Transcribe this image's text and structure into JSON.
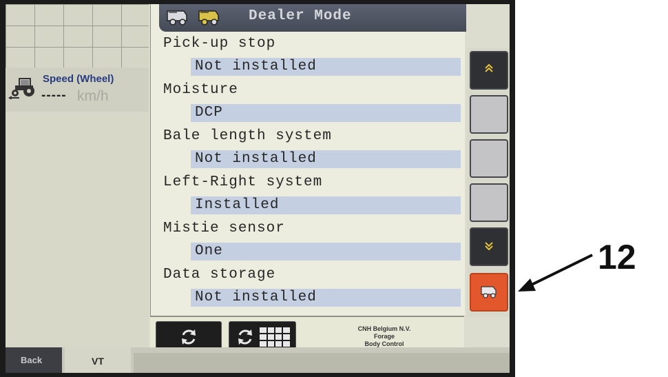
{
  "speed_widget": {
    "label": "Speed (Wheel)",
    "value": "-----",
    "unit": "km/h"
  },
  "header": {
    "title": "Dealer Mode"
  },
  "settings": [
    {
      "label": "Pick-up stop",
      "value": "Not installed"
    },
    {
      "label": "Moisture",
      "value": "DCP"
    },
    {
      "label": "Bale length system",
      "value": "Not installed"
    },
    {
      "label": "Left-Right system",
      "value": "Installed"
    },
    {
      "label": "Mistie sensor",
      "value": "One"
    },
    {
      "label": "Data storage",
      "value": "Not installed"
    }
  ],
  "company_info": {
    "line1": "CNH Belgium N.V.",
    "line2": "Forage",
    "line3": "Body Control"
  },
  "bottom_bar": {
    "back_label": "Back",
    "vt_label": "VT"
  },
  "callout": {
    "number": "12"
  },
  "softkeys": [
    {
      "icon": "chevron-up-icon"
    },
    {
      "icon": "blank"
    },
    {
      "icon": "blank"
    },
    {
      "icon": "blank"
    },
    {
      "icon": "chevron-down-icon"
    },
    {
      "icon": "baler-icon"
    }
  ],
  "colors": {
    "accent_orange": "#e2572b",
    "title_bar": "#4f5462",
    "value_highlight": "#c4d0e2",
    "label_blue": "#273c80"
  }
}
